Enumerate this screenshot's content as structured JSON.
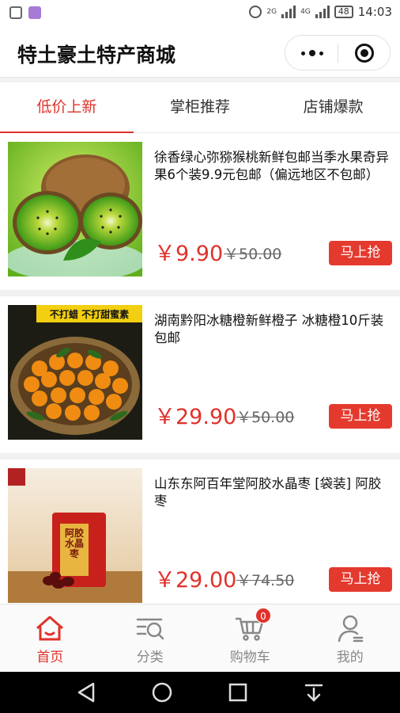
{
  "status_bar": {
    "network_label_1": "2G",
    "network_label_2": "4G",
    "battery": "48",
    "time": "14:03"
  },
  "app": {
    "title": "特土豪土特产商城"
  },
  "tabs": [
    {
      "label": "低价上新",
      "active": true
    },
    {
      "label": "掌柜推荐",
      "active": false
    },
    {
      "label": "店铺爆款",
      "active": false
    }
  ],
  "products": [
    {
      "name": "徐香绿心弥猕猴桃新鲜包邮当季水果奇异果6个装9.9元包邮（偏远地区不包邮）",
      "price": "￥9.90",
      "original_price": "￥50.00",
      "buy_label": "马上抢",
      "image": "kiwi-fruit-photo"
    },
    {
      "name": "湖南黔阳冰糖橙新鲜橙子 冰糖橙10斤装包邮",
      "price": "￥29.90",
      "original_price": "￥50.00",
      "buy_label": "马上抢",
      "image": "orange-basket-photo",
      "image_banner": "不打蜡 不打甜蜜素"
    },
    {
      "name": "山东东阿百年堂阿胶水晶枣 [袋装] 阿胶枣",
      "price": "￥29.00",
      "original_price": "￥74.50",
      "buy_label": "马上抢",
      "image": "jujube-bag-photo",
      "package_text": "阿胶水晶枣"
    }
  ],
  "tabbar": [
    {
      "label": "首页",
      "icon": "home-icon",
      "active": true
    },
    {
      "label": "分类",
      "icon": "category-icon",
      "active": false
    },
    {
      "label": "购物车",
      "icon": "cart-icon",
      "active": false,
      "badge": "0"
    },
    {
      "label": "我的",
      "icon": "profile-icon",
      "active": false
    }
  ],
  "colors": {
    "accent": "#e0322b",
    "buy_button": "#e43a2e"
  }
}
